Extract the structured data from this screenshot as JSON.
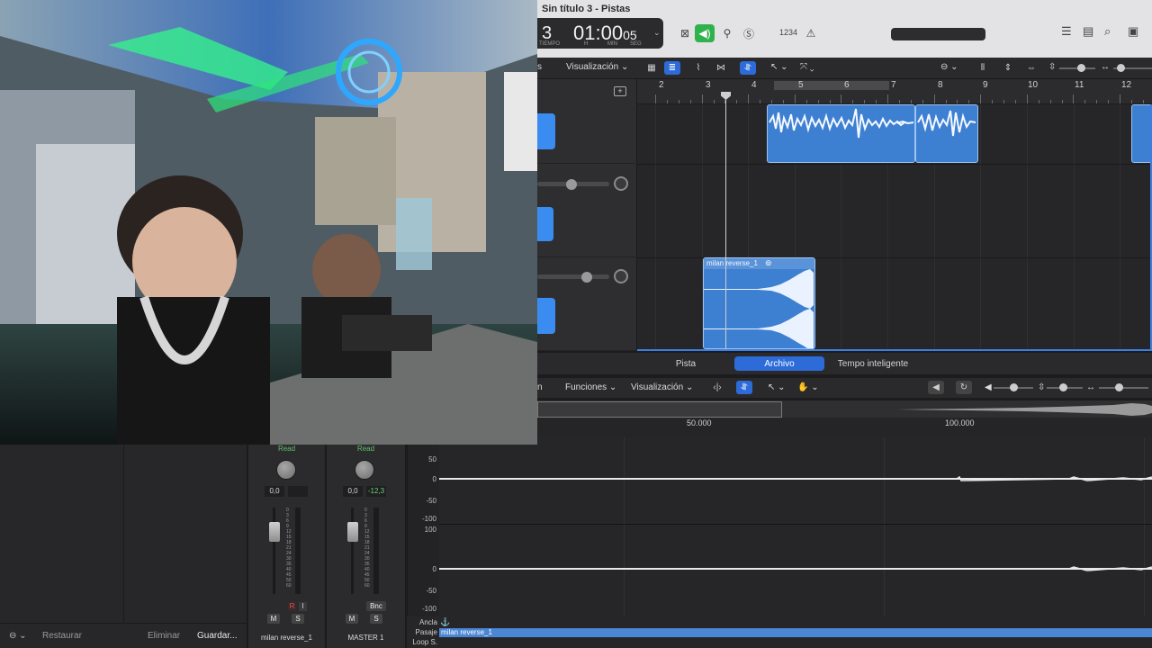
{
  "window": {
    "title": "Sin título 3 - Pistas"
  },
  "lcd": {
    "bar": "3",
    "time": "01:00",
    "time_small": "05",
    "labels": [
      "TIEMPO",
      "H",
      "MIN",
      "SEG"
    ]
  },
  "control_bar": {
    "count_in": "1234"
  },
  "tracks_toolbar": {
    "menu_partial": "s",
    "visualizacion": "Visualización"
  },
  "ruler": {
    "bars": [
      "2",
      "3",
      "4",
      "5",
      "6",
      "7",
      "8",
      "9",
      "10",
      "11",
      "12"
    ]
  },
  "regions": [
    {
      "name": "milan reverse_1"
    }
  ],
  "editor_tabs": {
    "pista": "Pista",
    "archivo": "Archivo",
    "tempo": "Tempo inteligente"
  },
  "editor_toolbar": {
    "partial": "n",
    "funciones": "Funciones",
    "visualizacion": "Visualización"
  },
  "sample_ruler": {
    "labels": [
      "50.000",
      "100.000"
    ]
  },
  "library_footer": {
    "restaurar": "Restaurar",
    "eliminar": "Eliminar",
    "guardar": "Guardar..."
  },
  "channel_strips": [
    {
      "automation": "Read",
      "value1": "0,0",
      "value2": "",
      "name": "milan reverse_1",
      "mute": "M",
      "solo": "S",
      "rec": "R",
      "input": "I"
    },
    {
      "automation": "Read",
      "value1": "0,0",
      "value2": "-12,3",
      "name": "MASTER 1",
      "mute": "M",
      "solo": "S",
      "bounce": "Bnc"
    }
  ],
  "fader_scale": [
    "0",
    "3",
    "6",
    "9",
    "12",
    "15",
    "18",
    "21",
    "24",
    "30",
    "35",
    "40",
    "45",
    "50",
    "60"
  ],
  "waveform_labels": [
    "50",
    "0",
    "-50",
    "-100",
    "100",
    "0",
    "-50",
    "-100"
  ],
  "markers": {
    "ancla": "Ancla",
    "pasaje": "Pasaje",
    "loop": "Loop S.",
    "region": "milan reverse_1"
  },
  "colors": {
    "accent": "#2d6bd8",
    "region": "#3d7fd1",
    "speaker_on": "#2fb14e",
    "read": "#62c06a"
  }
}
